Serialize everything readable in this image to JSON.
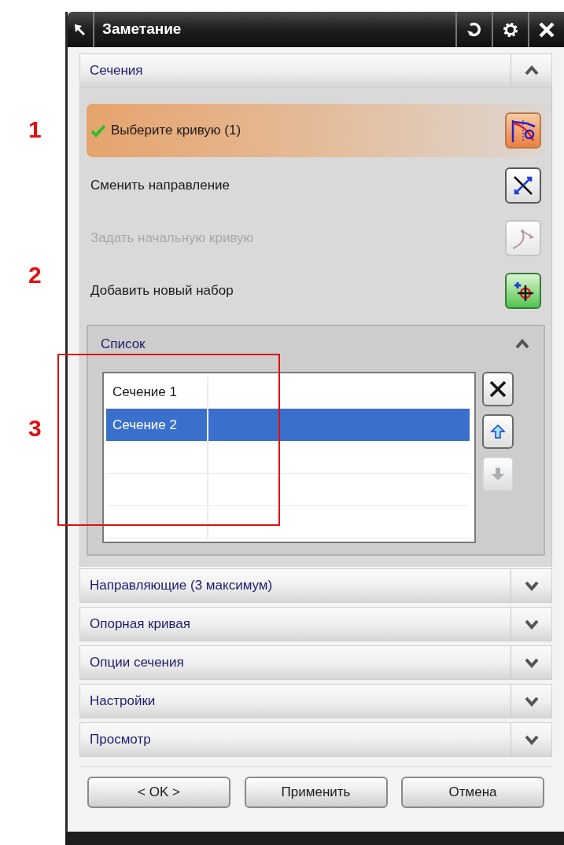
{
  "window": {
    "title": "Заметание"
  },
  "annotations": [
    {
      "label": "1"
    },
    {
      "label": "2"
    },
    {
      "label": "3",
      "framed": true
    }
  ],
  "section": {
    "title": "Сечения",
    "expanded": true,
    "rows": [
      {
        "kind": "select",
        "label": "Выберите кривую (1)",
        "done": true,
        "disabled": false
      },
      {
        "kind": "reverse",
        "label": "Сменить направление",
        "disabled": false
      },
      {
        "kind": "start",
        "label": "Задать начальную кривую",
        "disabled": true
      },
      {
        "kind": "add",
        "label": "Добавить новый набор",
        "disabled": false
      }
    ],
    "list": {
      "title": "Список",
      "expanded": true,
      "rows": [
        {
          "name": "Сечение 1",
          "selected": false
        },
        {
          "name": "Сечение 2",
          "selected": true
        }
      ],
      "buttons": [
        {
          "kind": "delete",
          "disabled": false
        },
        {
          "kind": "up",
          "disabled": false
        },
        {
          "kind": "down",
          "disabled": true
        }
      ]
    }
  },
  "collapsed_sections": [
    {
      "title": "Направляющие (3 максимум)",
      "expanded": false
    },
    {
      "title": "Опорная кривая",
      "expanded": false
    },
    {
      "title": "Опции сечения",
      "expanded": false
    },
    {
      "title": "Настройки",
      "expanded": false
    },
    {
      "title": "Просмотр",
      "expanded": false
    }
  ],
  "buttons": [
    "< OK >",
    "Применить",
    "Отмена"
  ]
}
